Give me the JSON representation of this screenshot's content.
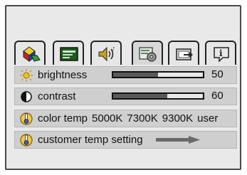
{
  "tabs": [
    {
      "icon": "color-shapes-icon",
      "active": false
    },
    {
      "icon": "display-settings-icon",
      "active": false
    },
    {
      "icon": "audio-icon",
      "active": false
    },
    {
      "icon": "system-gear-icon",
      "active": true
    },
    {
      "icon": "monitor-input-icon",
      "active": false
    },
    {
      "icon": "info-icon",
      "active": false
    }
  ],
  "rows": {
    "brightness": {
      "label": "brightness",
      "value": "50",
      "level": 0.5,
      "icon": "sun-icon"
    },
    "contrast": {
      "label": "contrast",
      "value": "60",
      "level": 0.6,
      "icon": "contrast-icon"
    },
    "color_temp": {
      "label": "color temp",
      "options": [
        "5000K",
        "7300K",
        "9300K",
        "user"
      ],
      "icon": "thermometer-icon"
    },
    "customer_temp": {
      "label": "customer temp setting",
      "icon": "thermometer-icon",
      "arrow": "arrow-right-icon"
    }
  },
  "colors": {
    "accent": "#5a5a5a",
    "panel": "#cfcfcf",
    "frame": "#e9e9e9"
  }
}
